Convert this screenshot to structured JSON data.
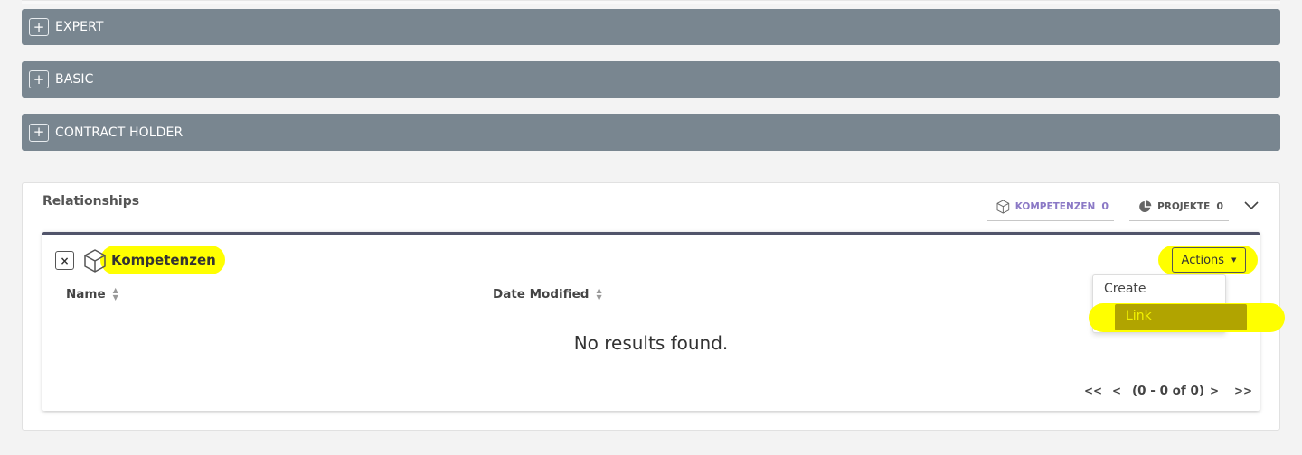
{
  "panels": [
    {
      "label": "EXPERT",
      "icon": "plus-icon"
    },
    {
      "label": "BASIC",
      "icon": "plus-icon"
    },
    {
      "label": "CONTRACT HOLDER",
      "icon": "plus-icon"
    }
  ],
  "relationships": {
    "title": "Relationships",
    "tabs": [
      {
        "label": "KOMPETENZEN",
        "count": "0",
        "icon": "cube-icon",
        "color": "#8b79c6"
      },
      {
        "label": "PROJEKTE",
        "count": "0",
        "icon": "pie-chart-icon",
        "color": "#555555"
      }
    ],
    "expand_icon": "chevron-down-icon"
  },
  "subpanel": {
    "title": "Kompetenzen",
    "close_label": "×",
    "actions_label": "Actions",
    "columns": [
      "Name",
      "Date Modified"
    ],
    "empty_message": "No results found.",
    "pagination": {
      "first": "<<",
      "prev": "<",
      "range": "(0 - 0 of 0)",
      "next": ">",
      "last": ">>"
    },
    "dropdown": [
      "Create",
      "Link"
    ]
  },
  "colors": {
    "panel_bar": "#798690",
    "highlight": "#ffff00",
    "accent": "#8b79c6",
    "subpanel_border": "#51546a"
  }
}
